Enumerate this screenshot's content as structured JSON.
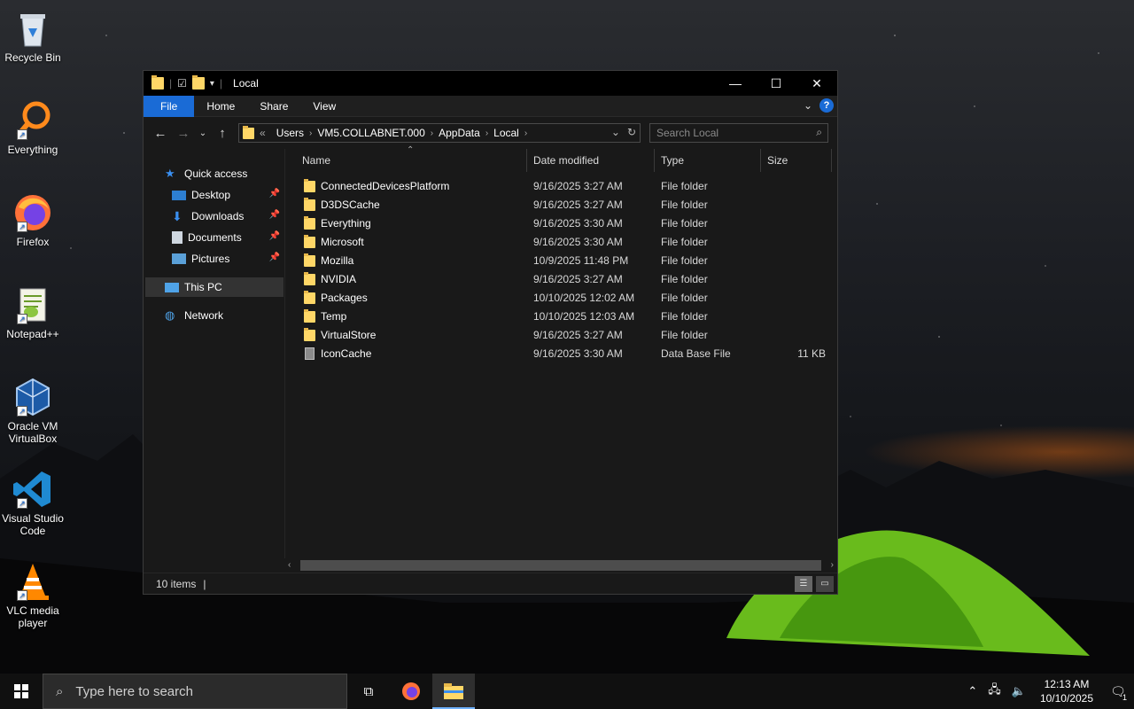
{
  "desktop": {
    "icons": [
      {
        "label": "Recycle Bin"
      },
      {
        "label": "Everything"
      },
      {
        "label": "Firefox"
      },
      {
        "label": "Notepad++"
      },
      {
        "label": "Oracle VM\nVirtualBox"
      },
      {
        "label": "Visual Studio\nCode"
      },
      {
        "label": "VLC media\nplayer"
      }
    ]
  },
  "window": {
    "title": "Local",
    "controls": {
      "minimize": "—",
      "maximize": "☐",
      "close": "✕"
    },
    "ribbon": {
      "tabs": [
        {
          "label": "File"
        },
        {
          "label": "Home"
        },
        {
          "label": "Share"
        },
        {
          "label": "View"
        }
      ],
      "help": "?"
    },
    "address": {
      "overflow": "«",
      "crumbs": [
        "Users",
        "VM5.COLLABNET.000",
        "AppData",
        "Local"
      ]
    },
    "search": {
      "placeholder": "Search Local"
    },
    "nav": {
      "quick_access": "Quick access",
      "items": [
        {
          "label": "Desktop"
        },
        {
          "label": "Downloads"
        },
        {
          "label": "Documents"
        },
        {
          "label": "Pictures"
        }
      ],
      "this_pc": "This PC",
      "network": "Network"
    },
    "columns": {
      "name": "Name",
      "date": "Date modified",
      "type": "Type",
      "size": "Size"
    },
    "files": [
      {
        "name": "ConnectedDevicesPlatform",
        "date": "9/16/2025 3:27 AM",
        "type": "File folder",
        "size": "",
        "kind": "folder"
      },
      {
        "name": "D3DSCache",
        "date": "9/16/2025 3:27 AM",
        "type": "File folder",
        "size": "",
        "kind": "folder"
      },
      {
        "name": "Everything",
        "date": "9/16/2025 3:30 AM",
        "type": "File folder",
        "size": "",
        "kind": "folder"
      },
      {
        "name": "Microsoft",
        "date": "9/16/2025 3:30 AM",
        "type": "File folder",
        "size": "",
        "kind": "folder"
      },
      {
        "name": "Mozilla",
        "date": "10/9/2025 11:48 PM",
        "type": "File folder",
        "size": "",
        "kind": "folder"
      },
      {
        "name": "NVIDIA",
        "date": "9/16/2025 3:27 AM",
        "type": "File folder",
        "size": "",
        "kind": "folder"
      },
      {
        "name": "Packages",
        "date": "10/10/2025 12:02 AM",
        "type": "File folder",
        "size": "",
        "kind": "folder"
      },
      {
        "name": "Temp",
        "date": "10/10/2025 12:03 AM",
        "type": "File folder",
        "size": "",
        "kind": "folder"
      },
      {
        "name": "VirtualStore",
        "date": "9/16/2025 3:27 AM",
        "type": "File folder",
        "size": "",
        "kind": "folder"
      },
      {
        "name": "IconCache",
        "date": "9/16/2025 3:30 AM",
        "type": "Data Base File",
        "size": "11 KB",
        "kind": "file"
      }
    ],
    "status": {
      "count": "10 items"
    }
  },
  "taskbar": {
    "search_placeholder": "Type here to search",
    "clock": {
      "time": "12:13 AM",
      "date": "10/10/2025"
    },
    "notification_count": "1"
  },
  "colors": {
    "accent": "#1a6bd6",
    "folder": "#ffd767"
  }
}
